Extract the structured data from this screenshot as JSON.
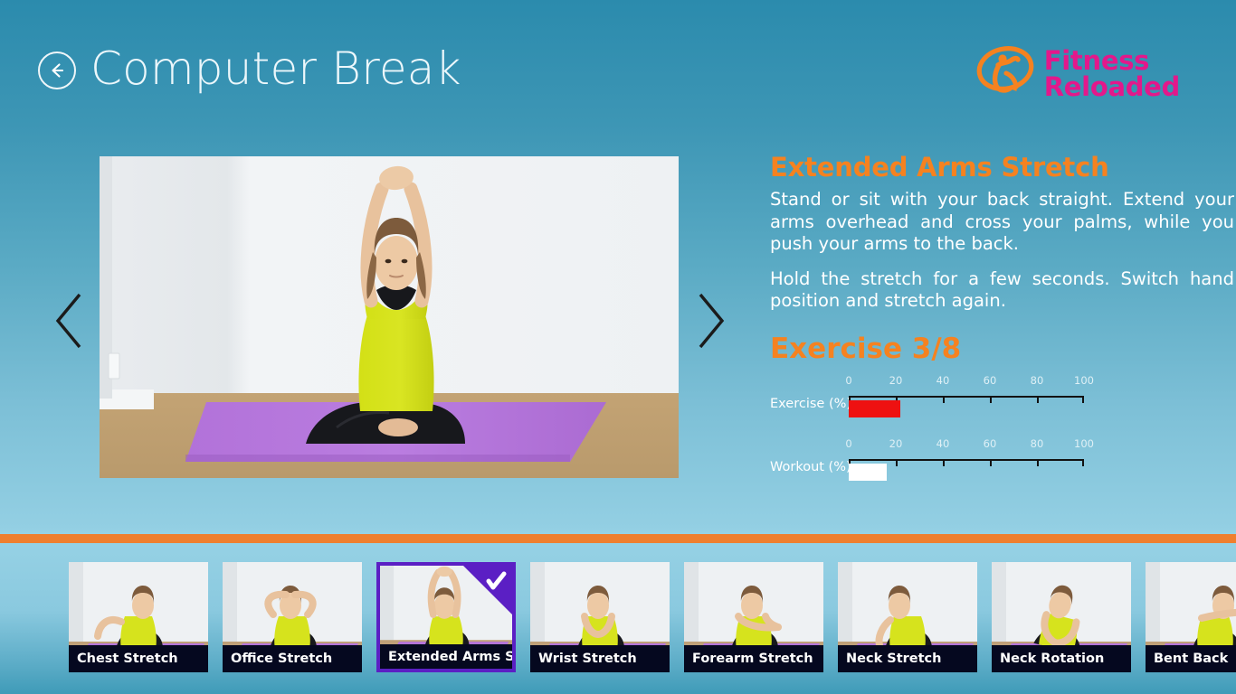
{
  "header": {
    "title": "Computer Break",
    "back_icon": "back-arrow-circle-icon"
  },
  "logo": {
    "icon": "fitness-reloaded-runner-icon",
    "line1": "Fitness",
    "line2": "Reloaded",
    "text_color": "#e3188b",
    "icon_color": "#f58220"
  },
  "viewer": {
    "prev_icon": "chevron-left-icon",
    "next_icon": "chevron-right-icon",
    "image_alt": "Extended Arms Stretch demonstration"
  },
  "detail": {
    "exercise_name": "Extended Arms Stretch",
    "paragraph1": "Stand or sit with your back straight. Extend your arms overhead and cross your palms, while you push your arms to the back.",
    "paragraph2": "Hold the stretch for a few seconds. Switch hand position and stretch again.",
    "progress_title": "Exercise 3/8",
    "accent_color": "#f58220"
  },
  "chart_data": {
    "type": "bar",
    "title": "Exercise 3/8",
    "orientation": "horizontal",
    "xlabel": "",
    "ylabel": "",
    "xlim": [
      0,
      100
    ],
    "grid": false,
    "ticks": [
      0,
      20,
      40,
      60,
      80,
      100
    ],
    "categories": [
      "Exercise (%)",
      "Workout (%)"
    ],
    "values": [
      22,
      16
    ],
    "series": [
      {
        "name": "Exercise (%)",
        "value": 22,
        "color": "#ee1111"
      },
      {
        "name": "Workout (%)",
        "value": 16,
        "color": "#ffffff"
      }
    ]
  },
  "divider": {
    "color": "#ef7f2e"
  },
  "thumbnails": {
    "selected_index": 2,
    "selected_border_color": "#5b1fc4",
    "check_icon": "check-mark-icon",
    "items": [
      {
        "label": "Chest Stretch"
      },
      {
        "label": "Office Stretch"
      },
      {
        "label": "Extended Arms Stretch"
      },
      {
        "label": "Wrist Stretch"
      },
      {
        "label": "Forearm Stretch"
      },
      {
        "label": "Neck Stretch"
      },
      {
        "label": "Neck Rotation"
      },
      {
        "label": "Bent Back"
      }
    ]
  }
}
